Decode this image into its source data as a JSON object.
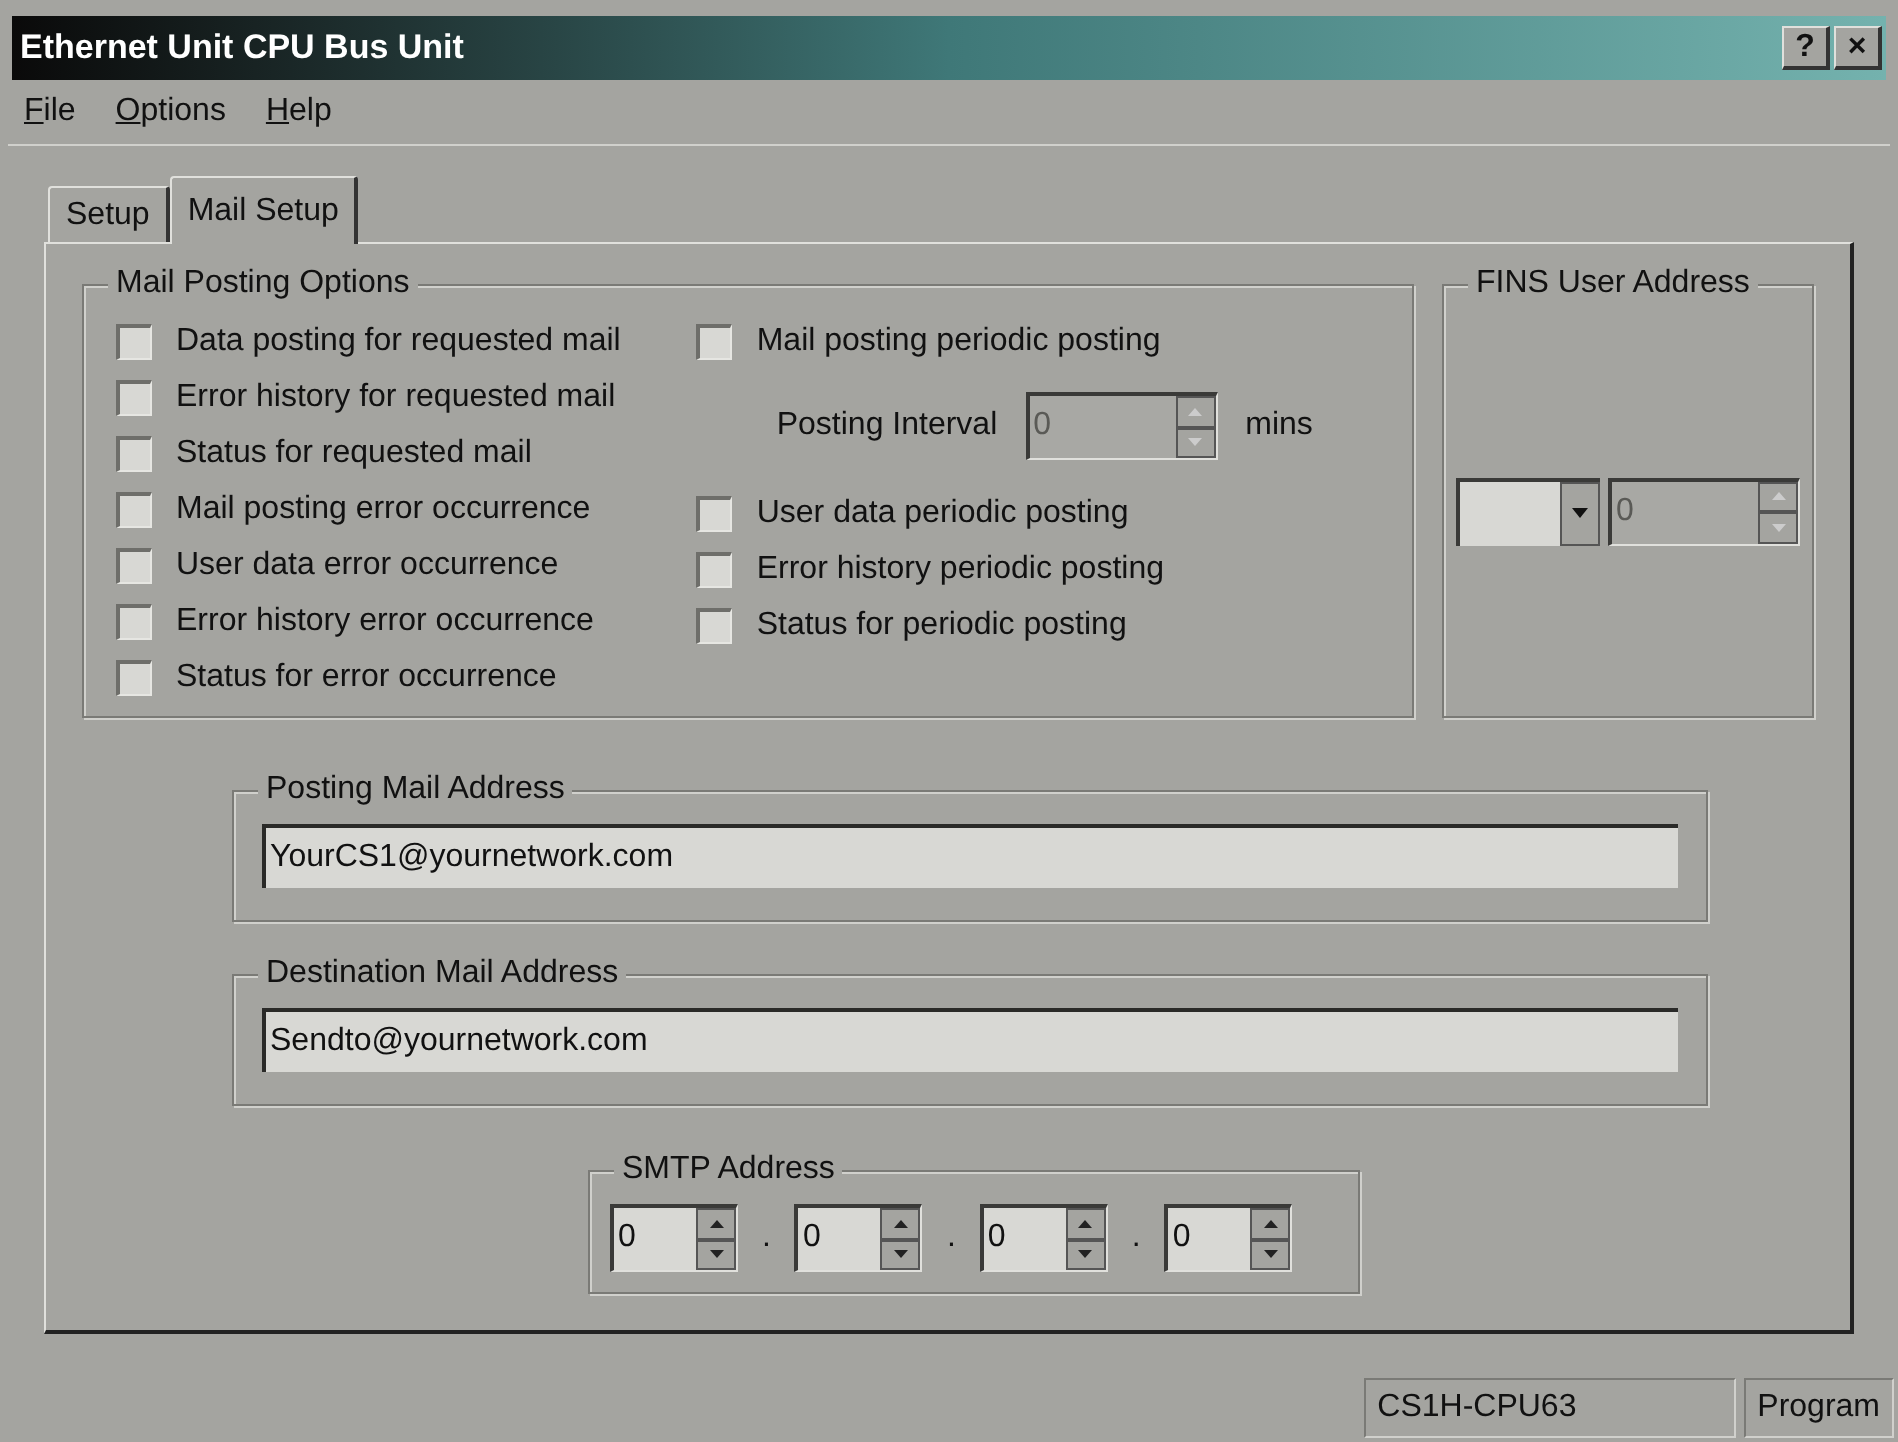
{
  "window": {
    "title": "Ethernet Unit CPU Bus Unit",
    "title_buttons": [
      "?",
      "×"
    ]
  },
  "menu": [
    "File",
    "Options",
    "Help"
  ],
  "tabs": [
    {
      "label": "Setup",
      "selected": false
    },
    {
      "label": "Mail Setup",
      "selected": true
    }
  ],
  "mail_posting_options": {
    "title": "Mail Posting Options",
    "left": [
      {
        "label": "Data posting for requested mail",
        "checked": false
      },
      {
        "label": "Error history for requested mail",
        "checked": false
      },
      {
        "label": "Status for requested mail",
        "checked": false
      },
      {
        "label": "Mail posting error occurrence",
        "checked": false
      },
      {
        "label": "User data error occurrence",
        "checked": false
      },
      {
        "label": "Error history error occurrence",
        "checked": false
      },
      {
        "label": "Status for error occurrence",
        "checked": false
      }
    ],
    "right": [
      {
        "kind": "checkbox",
        "label": "Mail posting periodic posting",
        "checked": false
      },
      {
        "kind": "interval",
        "label": "Posting Interval",
        "value": "0",
        "unit": "mins",
        "disabled": true
      },
      {
        "kind": "checkbox",
        "label": "User data periodic posting",
        "checked": false
      },
      {
        "kind": "checkbox",
        "label": "Error history periodic posting",
        "checked": false
      },
      {
        "kind": "checkbox",
        "label": "Status for periodic posting",
        "checked": false
      }
    ]
  },
  "fins_user_address": {
    "title": "FINS User Address",
    "spin": {
      "value": "0",
      "disabled": true
    }
  },
  "posting_mail_address": {
    "title": "Posting Mail Address",
    "value": "YourCS1@yournetwork.com"
  },
  "destination_mail_address": {
    "title": "Destination Mail Address",
    "value": "Sendto@yournetwork.com"
  },
  "smtp_address": {
    "title": "SMTP Address",
    "octets": [
      "0",
      "0",
      "0",
      "0"
    ],
    "separators": [
      ".",
      ".",
      "."
    ]
  },
  "status_bar": [
    "CS1H-CPU63",
    "Program"
  ]
}
